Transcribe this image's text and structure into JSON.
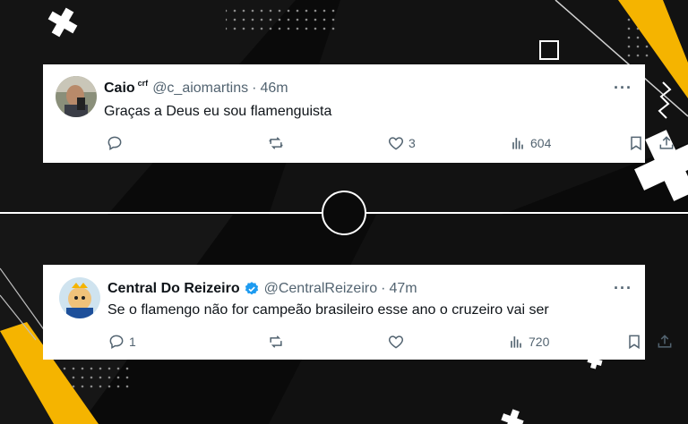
{
  "tweets": [
    {
      "name": "Caio",
      "flair": "crf",
      "handle": "@c_aiomartins",
      "separator": "·",
      "time": "46m",
      "verified": false,
      "text": "Graças a Deus eu sou flamenguista",
      "replies": "",
      "retweets": "",
      "likes": "3",
      "views": "604",
      "more": "···"
    },
    {
      "name": "Central Do Reizeiro",
      "flair": "",
      "handle": "@CentralReizeiro",
      "separator": "·",
      "time": "47m",
      "verified": true,
      "text": "Se o flamengo não for campeão brasileiro esse ano o cruzeiro vai ser",
      "replies": "1",
      "retweets": "",
      "likes": "",
      "views": "720",
      "more": "···"
    }
  ],
  "colors": {
    "background": "#0a0a0a",
    "accent_yellow": "#f5b400",
    "verified_blue": "#1d9bf0",
    "muted_text": "#536471"
  }
}
